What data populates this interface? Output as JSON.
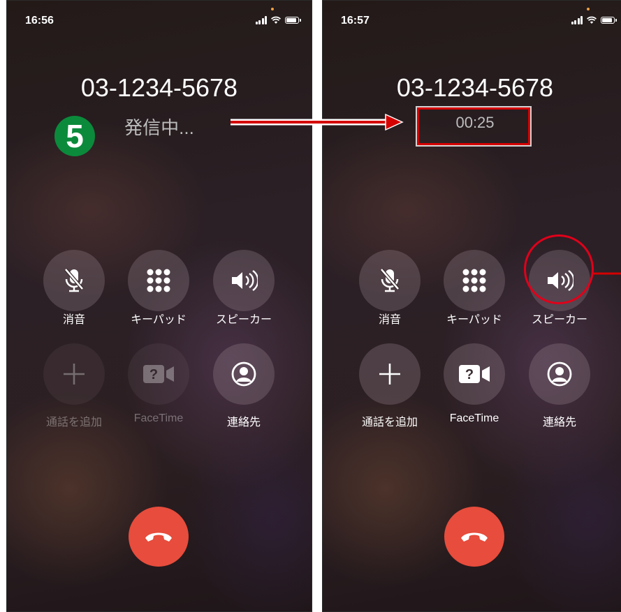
{
  "left": {
    "time": "16:56",
    "number": "03-1234-5678",
    "status": "発信中...",
    "step_badge": "5",
    "buttons": {
      "mute": "消音",
      "keypad": "キーパッド",
      "speaker": "スピーカー",
      "add_call": "通話を追加",
      "facetime": "FaceTime",
      "contacts": "連絡先"
    }
  },
  "right": {
    "time": "16:57",
    "number": "03-1234-5678",
    "duration": "00:25",
    "buttons": {
      "mute": "消音",
      "keypad": "キーパッド",
      "speaker": "スピーカー",
      "add_call": "通話を追加",
      "facetime": "FaceTime",
      "contacts": "連絡先"
    }
  },
  "icons": {
    "mute": "mic-slash-icon",
    "keypad": "keypad-grid-icon",
    "speaker": "speaker-icon",
    "add_call": "plus-icon",
    "facetime": "facetime-video-icon",
    "contacts": "person-circle-icon",
    "end_call": "phone-hangup-icon"
  },
  "colors": {
    "annotation_red": "#d50000",
    "badge_green": "#0b8a3c",
    "end_call_red": "#e74c3c"
  }
}
